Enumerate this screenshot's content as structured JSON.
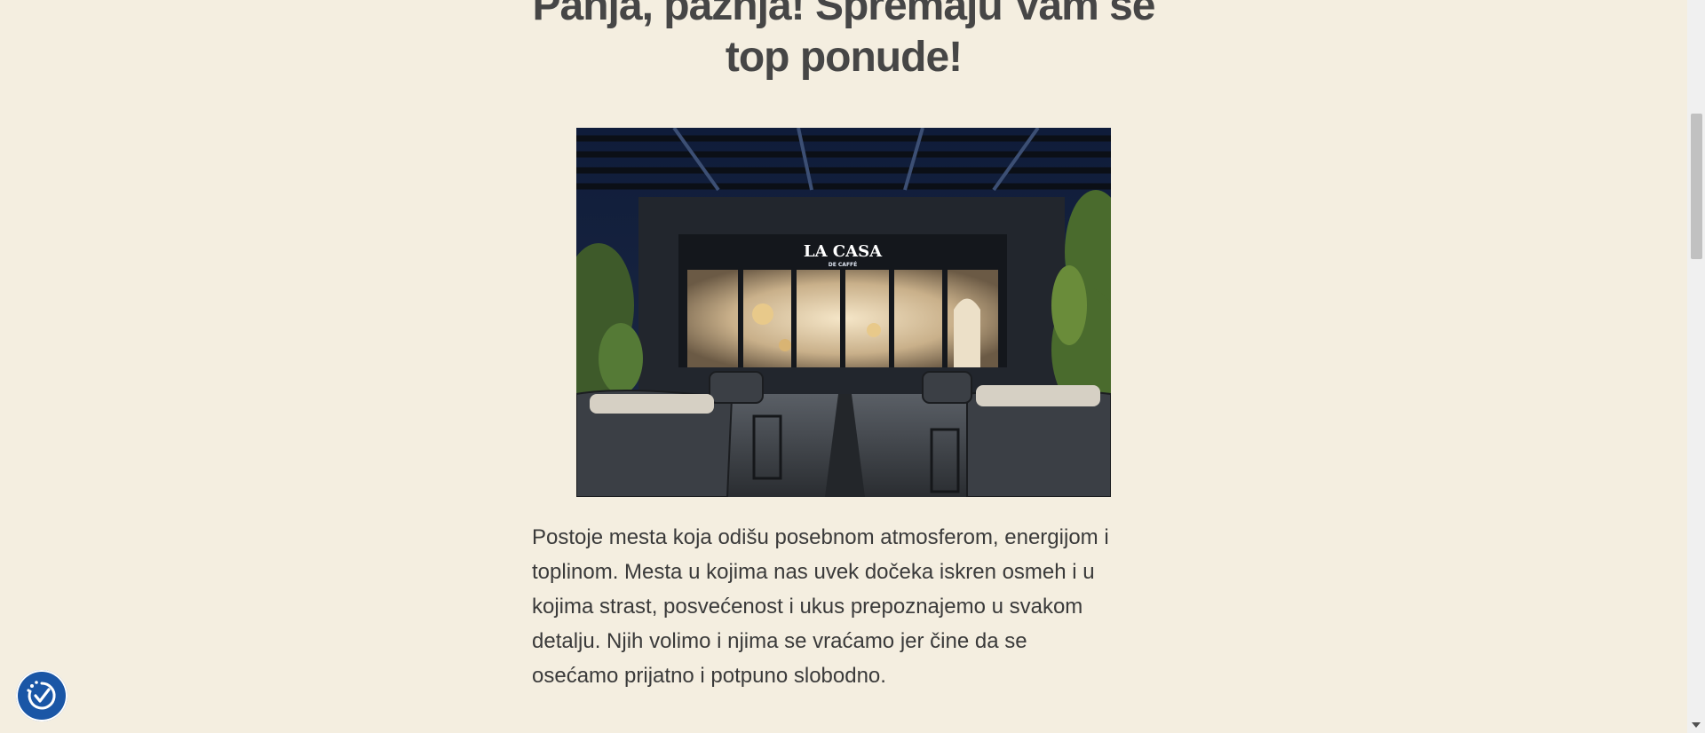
{
  "article": {
    "headline": "Panja, pažnja! Spremaju Vam se top ponude!",
    "image_sign_text": "LA CASA",
    "image_sign_subtext": "DE CAFFÉ",
    "paragraph": "Postoje mesta koja odišu posebnom atmosferom, energijom i toplinom. Mesta u kojima nas uvek dočeka iskren osmeh i u kojima strast, posvećenost i ukus prepoznajemo u svakom detalju. Njih volimo i njima se vraćamo jer čine da se osećamo prijatno i potpuno slobodno."
  },
  "widgets": {
    "accessibility_icon": "accessibility-check-icon"
  },
  "colors": {
    "background": "#f4eee0",
    "headline": "#464646",
    "text": "#3a3a3a",
    "accessibility_button": "#1a56a6"
  }
}
